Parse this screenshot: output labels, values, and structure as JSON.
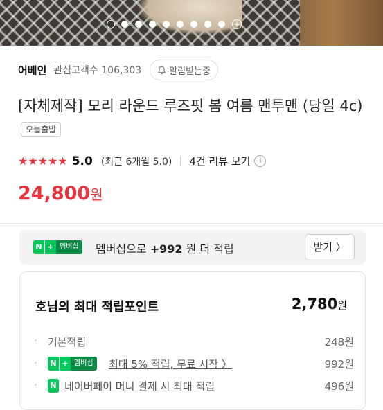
{
  "carousel": {
    "count": 9,
    "active_index": 0,
    "more_symbol": "+"
  },
  "seller": {
    "name": "어베인",
    "followers_label": "관심고객수 106,303",
    "notify_label": "알림받는중"
  },
  "product": {
    "title": "[자체제작] 모리 라운드 루즈핏 봄 여름 맨투맨 (당일 4c)",
    "badge": "오늘출발"
  },
  "rating": {
    "stars": "★★★★★",
    "score": "5.0",
    "recent": "(최근 6개월 5.0)",
    "review_link": "4건 리뷰 보기",
    "info_icon": "i"
  },
  "price": {
    "amount": "24,800",
    "unit": "원"
  },
  "membership": {
    "badge_n": "N",
    "badge_plus": "+",
    "badge_label": "멤버십",
    "text_prefix": "멤버십으로",
    "points": "+992",
    "text_suffix": "원 더 적립",
    "button_label": "받기 〉"
  },
  "points": {
    "title": "호님의 최대 적립포인트",
    "total": "2,780",
    "total_unit": "원",
    "rows": [
      {
        "label": "기본적립",
        "value": "248원"
      },
      {
        "label": "최대 5% 적립, 무료 시작 〉",
        "value": "992원"
      },
      {
        "label": "네이버페이 머니 결제 시 최대 적립",
        "value": "496원"
      }
    ]
  },
  "colors": {
    "accent": "#e8323c",
    "naver_green": "#03c75a"
  }
}
